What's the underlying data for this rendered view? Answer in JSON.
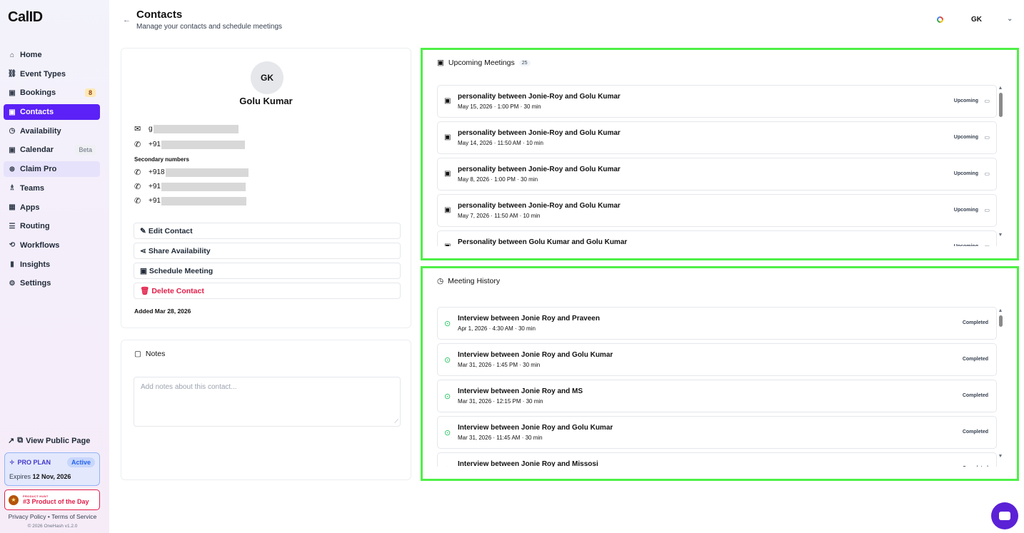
{
  "brand": {
    "logo": "CalID"
  },
  "sidebar": {
    "items": [
      {
        "label": "Home",
        "icon": "home-icon",
        "glyph": "⌂"
      },
      {
        "label": "Event Types",
        "icon": "link-icon",
        "glyph": "⛓"
      },
      {
        "label": "Bookings",
        "icon": "calendar-icon",
        "glyph": "▣",
        "count": "8"
      },
      {
        "label": "Contacts",
        "icon": "contacts-icon",
        "glyph": "▣",
        "active": true
      },
      {
        "label": "Availability",
        "icon": "clock-icon",
        "glyph": "◷"
      },
      {
        "label": "Calendar",
        "icon": "calendar-icon",
        "glyph": "▣",
        "tag": "Beta"
      },
      {
        "label": "Claim Pro",
        "icon": "sparkle-icon",
        "glyph": "⊛",
        "highlight": true
      },
      {
        "label": "Teams",
        "icon": "users-icon",
        "glyph": "♗"
      },
      {
        "label": "Apps",
        "icon": "grid-icon",
        "glyph": "▦"
      },
      {
        "label": "Routing",
        "icon": "routing-icon",
        "glyph": "☰"
      },
      {
        "label": "Workflows",
        "icon": "workflow-icon",
        "glyph": "⟲"
      },
      {
        "label": "Insights",
        "icon": "chart-icon",
        "glyph": "▮"
      },
      {
        "label": "Settings",
        "icon": "gear-icon",
        "glyph": "⚙"
      }
    ],
    "view_public": "View Public Page",
    "plan": {
      "title": "PRO PLAN",
      "status": "Active",
      "expires_label": "Expires",
      "expires_date": "12 Nov, 2026"
    },
    "product_hunt": {
      "small": "PRODUCT HUNT",
      "big": "#3 Product of the Day"
    },
    "footer_links": "Privacy Policy • Terms of Service",
    "copyright": "© 2026 OneHash v1.2.0"
  },
  "header": {
    "title": "Contacts",
    "subtitle": "Manage your contacts and schedule meetings",
    "user_initials": "GK"
  },
  "contact": {
    "initials": "GK",
    "name": "Golu Kumar",
    "email_prefix": "g",
    "phone_prefix": "+91",
    "secondary_label": "Secondary numbers",
    "secondary": [
      "+918",
      "+91",
      "+91"
    ],
    "actions": {
      "edit": "Edit Contact",
      "share": "Share Availability",
      "schedule": "Schedule Meeting",
      "delete": "Delete Contact"
    },
    "added": "Added Mar 28, 2026"
  },
  "notes": {
    "title": "Notes",
    "placeholder": "Add notes about this contact..."
  },
  "upcoming": {
    "title": "Upcoming Meetings",
    "count": "25",
    "meetings": [
      {
        "title": "personality between Jonie-Roy and Golu Kumar",
        "when": "May 15, 2026 · 1:00 PM",
        "duration": "30 min",
        "status": "Upcoming"
      },
      {
        "title": "personality between Jonie-Roy and Golu Kumar",
        "when": "May 14, 2026 · 11:50 AM",
        "duration": "10 min",
        "status": "Upcoming"
      },
      {
        "title": "personality between Jonie-Roy and Golu Kumar",
        "when": "May 8, 2026 · 1:00 PM",
        "duration": "30 min",
        "status": "Upcoming"
      },
      {
        "title": "personality between Jonie-Roy and Golu Kumar",
        "when": "May 7, 2026 · 11:50 AM",
        "duration": "10 min",
        "status": "Upcoming"
      },
      {
        "title": "Personality between Golu Kumar and Golu Kumar",
        "when": "",
        "duration": "",
        "status": "Upcoming"
      }
    ]
  },
  "history": {
    "title": "Meeting History",
    "meetings": [
      {
        "title": "Interview between Jonie Roy and Praveen",
        "when": "Apr 1, 2026 · 4:30 AM",
        "duration": "30 min",
        "status": "Completed"
      },
      {
        "title": "Interview between Jonie Roy and Golu Kumar",
        "when": "Mar 31, 2026 · 1:45 PM",
        "duration": "30 min",
        "status": "Completed"
      },
      {
        "title": "Interview between Jonie Roy and MS",
        "when": "Mar 31, 2026 · 12:15 PM",
        "duration": "30 min",
        "status": "Completed"
      },
      {
        "title": "Interview between Jonie Roy and Golu Kumar",
        "when": "Mar 31, 2026 · 11:45 AM",
        "duration": "30 min",
        "status": "Completed"
      },
      {
        "title": "Interview between Jonie Roy and Missosi",
        "when": "",
        "duration": "",
        "status": "Completed"
      }
    ]
  },
  "colors": {
    "accent": "#5b21f6",
    "highlight_border": "#4ef046",
    "danger": "#e11d48",
    "success": "#22c55e"
  }
}
